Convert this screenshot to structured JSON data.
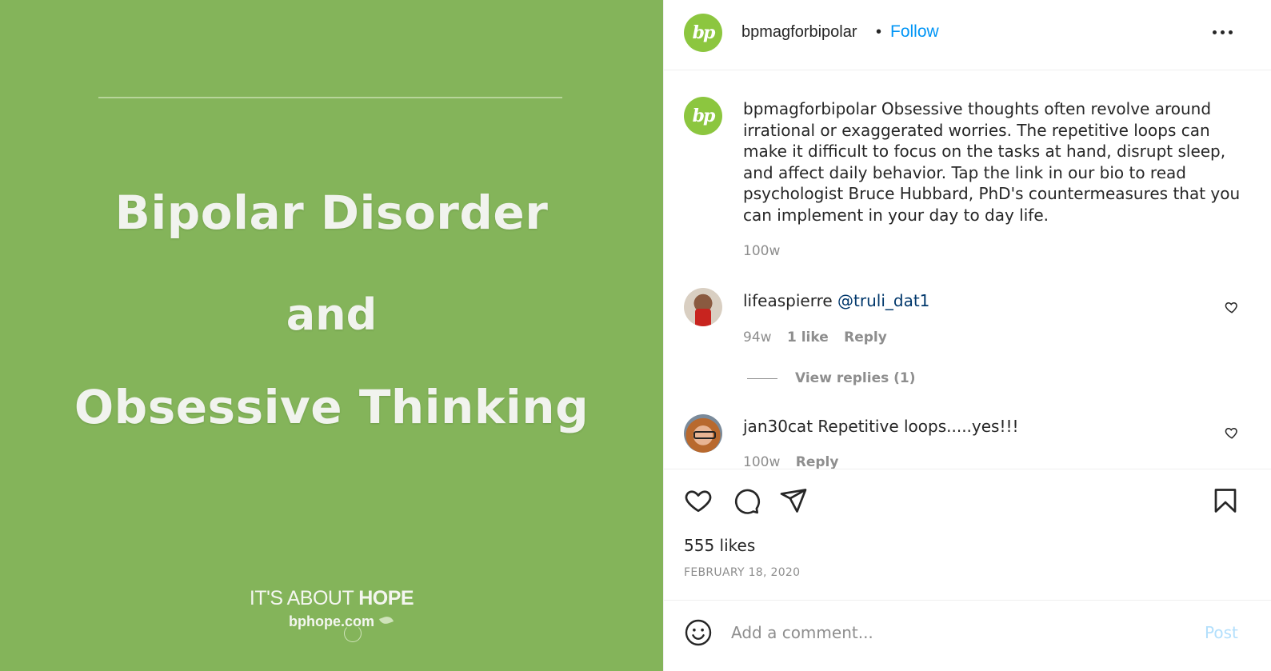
{
  "media": {
    "line1": "Bipolar Disorder",
    "line2": "and",
    "line3": "Obsessive Thinking",
    "brand_tag_light": "IT'S ABOUT ",
    "brand_tag_bold": "HOPE",
    "brand_url": "bphope.com",
    "background_color": "#84b45a"
  },
  "header": {
    "avatar_text": "bp",
    "username": "bpmagforbipolar",
    "separator": "•",
    "follow_label": "Follow"
  },
  "caption": {
    "avatar_text": "bp",
    "username": "bpmagforbipolar",
    "text": " Obsessive thoughts often revolve around irrational or exaggerated worries. The repetitive loops can make it difficult to focus on the tasks at hand, disrupt sleep, and affect daily behavior. Tap the link in our bio to read psychologist Bruce Hubbard, PhD's countermeasures that you can implement in your day to day life.",
    "time": "100w"
  },
  "comments": [
    {
      "username": "lifeaspierre",
      "text": "@truli_dat1",
      "time": "94w",
      "likes": "1 like",
      "reply_label": "Reply",
      "view_replies": "View replies (1)"
    },
    {
      "username": "jan30cat",
      "text": " Repetitive loops.....yes!!!",
      "time": "100w",
      "reply_label": "Reply"
    }
  ],
  "actions": {
    "likes": "555 likes",
    "date": "FEBRUARY 18, 2020"
  },
  "composer": {
    "placeholder": "Add a comment...",
    "post_label": "Post"
  },
  "colors": {
    "accent": "#0095f6",
    "muted": "#8e8e8e",
    "brand_green": "#8cc63f"
  }
}
